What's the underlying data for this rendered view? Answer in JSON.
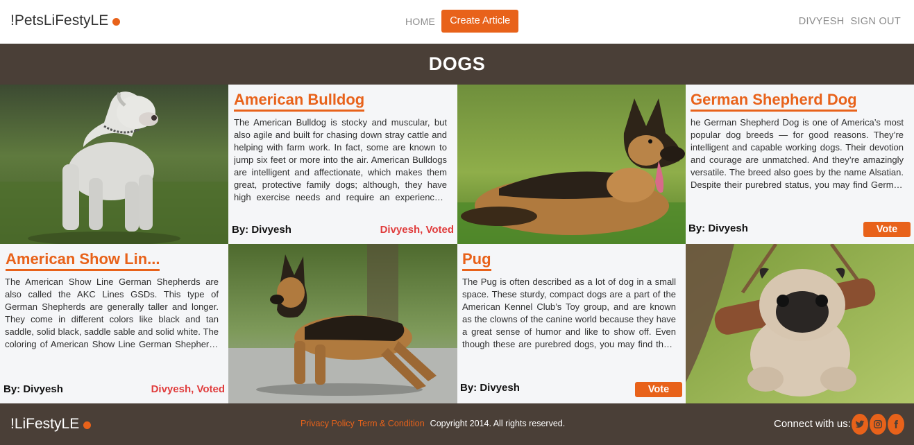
{
  "header": {
    "brand": "!PetsLiFestyLE",
    "nav": {
      "home": "HOME",
      "create": "Create Article"
    },
    "user": {
      "name": "DIVYESH",
      "signout": "SIGN OUT"
    }
  },
  "section": {
    "title": "DOGS"
  },
  "articles": [
    {
      "title": "American Bulldog",
      "body": "The American Bulldog is stocky and muscular, but also agile and built for chasing down stray cattle and helping with farm work. In fact, some are known to jump six feet or more into the air. American Bulldogs are intelligent and affectionate, which makes them great, protective family dogs; although, they have high exercise needs and require an experienced, active owner who can keep up with them.",
      "author": "By: Divyesh",
      "status": "Divyesh, Voted"
    },
    {
      "title": "German Shepherd Dog",
      "body": "he German Shepherd Dog is one of America’s most popular dog breeds — for good reasons. They’re intelligent and capable working dogs. Their devotion and courage are unmatched. And they’re amazingly versatile. The breed also goes by the name Alsatian. Despite their purebred status, you may find German Shepherds in shelters and breed specific rescues. Remember to adopt!",
      "author": "By: Divyesh",
      "vote": "Vote"
    },
    {
      "title": "American Show Lin...",
      "body": "The American Show Line German Shepherds are also called the AKC Lines GSDs. This type of German Shepherds are generally taller and longer. They come in different colors like black and tan saddle, solid black, saddle sable and solid white. The coloring of American Show Line German Shepherds coat is typically lighter. This type of German Shepherd are generally more laid back.",
      "author": "By: Divyesh",
      "status": "Divyesh, Voted"
    },
    {
      "title": "Pug",
      "body": "The Pug is often described as a lot of dog in a small space. These sturdy, compact dogs are a part of the American Kennel Club’s Toy group, and are known as the clowns of the canine world because they have a great sense of humor and like to show off. Even though these are purebred dogs, you may find them in the care of shelters or rescue groups. Remember to adopt!",
      "author": "By: Divyesh",
      "vote": "Vote"
    }
  ],
  "footer": {
    "brand": "!LiFestyLE",
    "privacy": "Privacy Policy",
    "terms": "Term & Condition",
    "copyright": "Copyright 2014. All rights reserved.",
    "connect": "Connect with us:"
  },
  "icons": [
    "twitter-icon",
    "instagram-icon",
    "facebook-icon"
  ],
  "colors": {
    "accent": "#e8621a",
    "dark": "#4a3f37",
    "voted": "#e03c3c",
    "card": "#f5f6f8"
  }
}
